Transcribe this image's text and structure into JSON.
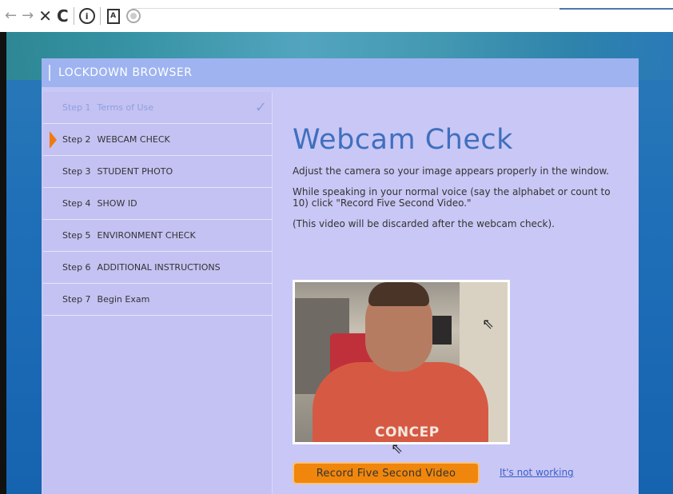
{
  "app": {
    "title": "LOCKDOWN BROWSER"
  },
  "browser": {
    "back_icon": "back-arrow-icon",
    "forward_icon": "forward-arrow-icon",
    "close_icon": "close-icon",
    "reload_icon": "reload-icon",
    "info_icon": "info-icon",
    "pdf_icon": "document-icon",
    "webcam_icon": "webcam-icon"
  },
  "sidebar": {
    "steps": [
      {
        "num": "Step 1",
        "label": "Terms of Use",
        "state": "done"
      },
      {
        "num": "Step 2",
        "label": "WEBCAM CHECK",
        "state": "active"
      },
      {
        "num": "Step 3",
        "label": "STUDENT PHOTO",
        "state": "pending"
      },
      {
        "num": "Step 4",
        "label": "SHOW ID",
        "state": "pending"
      },
      {
        "num": "Step 5",
        "label": "ENVIRONMENT CHECK",
        "state": "pending"
      },
      {
        "num": "Step 6",
        "label": "ADDITIONAL INSTRUCTIONS",
        "state": "pending"
      },
      {
        "num": "Step 7",
        "label": "Begin Exam",
        "state": "pending"
      }
    ],
    "check_glyph": "✓"
  },
  "main": {
    "heading": "Webcam Check",
    "para1": "Adjust the camera so your image appears properly in the window.",
    "para2": "While speaking in your normal voice (say the alphabet or count to 10) click \"Record Five Second Video.\"",
    "para3": "(This video will be discarded after the webcam check).",
    "shirt_text": "CONCEP",
    "record_button": "Record Five Second Video",
    "not_working_link": "It's not working"
  },
  "colors": {
    "accent": "#f0860c",
    "heading": "#3f6fbf",
    "titlebar": "#9eb3f0",
    "panel": "#c9c7f5"
  }
}
